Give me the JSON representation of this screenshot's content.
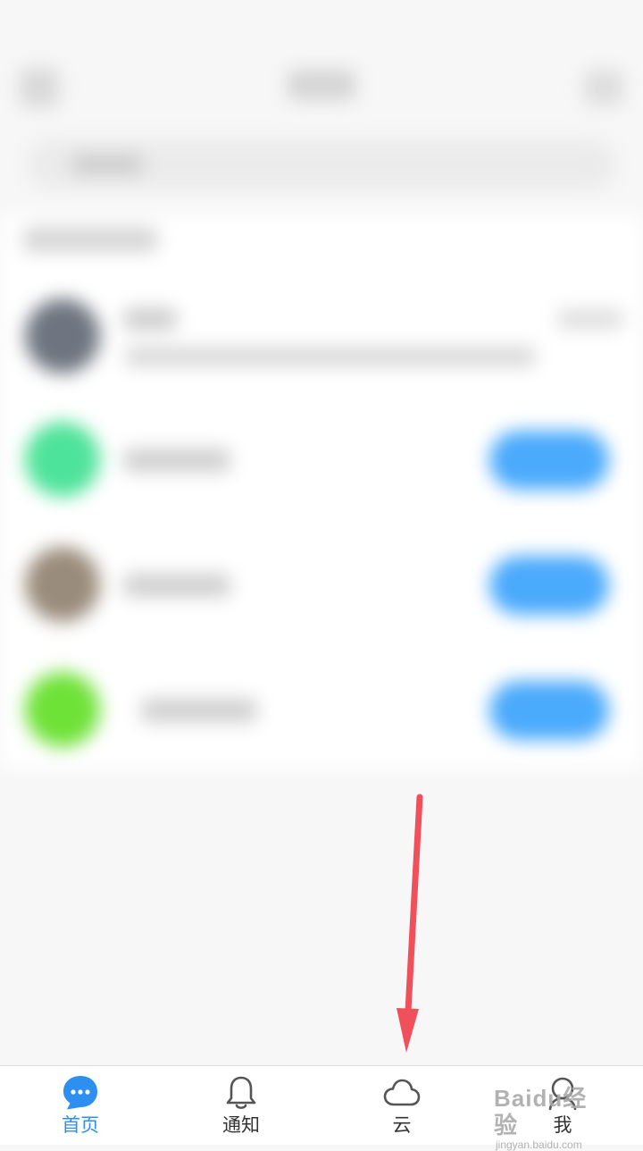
{
  "tabs": [
    {
      "label": "首页",
      "icon": "chat-bubble-icon",
      "active": true
    },
    {
      "label": "通知",
      "icon": "bell-icon",
      "active": false
    },
    {
      "label": "云",
      "icon": "cloud-icon",
      "active": false
    },
    {
      "label": "我",
      "icon": "person-icon",
      "active": false
    }
  ],
  "colors": {
    "accent": "#2d8ff0",
    "row_button": "#4aaafc",
    "annotation_arrow": "#f0505a"
  },
  "watermark": {
    "main": "Baidu经验",
    "sub": "jingyan.baidu.com"
  }
}
